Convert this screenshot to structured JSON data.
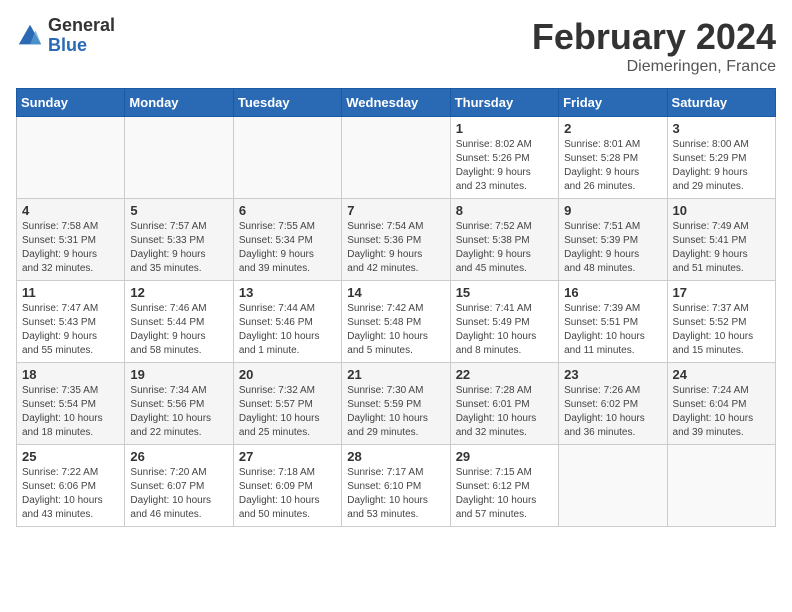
{
  "header": {
    "logo_general": "General",
    "logo_blue": "Blue",
    "month_year": "February 2024",
    "location": "Diemeringen, France"
  },
  "calendar": {
    "days_of_week": [
      "Sunday",
      "Monday",
      "Tuesday",
      "Wednesday",
      "Thursday",
      "Friday",
      "Saturday"
    ],
    "weeks": [
      [
        {
          "day": "",
          "info": ""
        },
        {
          "day": "",
          "info": ""
        },
        {
          "day": "",
          "info": ""
        },
        {
          "day": "",
          "info": ""
        },
        {
          "day": "1",
          "info": "Sunrise: 8:02 AM\nSunset: 5:26 PM\nDaylight: 9 hours\nand 23 minutes."
        },
        {
          "day": "2",
          "info": "Sunrise: 8:01 AM\nSunset: 5:28 PM\nDaylight: 9 hours\nand 26 minutes."
        },
        {
          "day": "3",
          "info": "Sunrise: 8:00 AM\nSunset: 5:29 PM\nDaylight: 9 hours\nand 29 minutes."
        }
      ],
      [
        {
          "day": "4",
          "info": "Sunrise: 7:58 AM\nSunset: 5:31 PM\nDaylight: 9 hours\nand 32 minutes."
        },
        {
          "day": "5",
          "info": "Sunrise: 7:57 AM\nSunset: 5:33 PM\nDaylight: 9 hours\nand 35 minutes."
        },
        {
          "day": "6",
          "info": "Sunrise: 7:55 AM\nSunset: 5:34 PM\nDaylight: 9 hours\nand 39 minutes."
        },
        {
          "day": "7",
          "info": "Sunrise: 7:54 AM\nSunset: 5:36 PM\nDaylight: 9 hours\nand 42 minutes."
        },
        {
          "day": "8",
          "info": "Sunrise: 7:52 AM\nSunset: 5:38 PM\nDaylight: 9 hours\nand 45 minutes."
        },
        {
          "day": "9",
          "info": "Sunrise: 7:51 AM\nSunset: 5:39 PM\nDaylight: 9 hours\nand 48 minutes."
        },
        {
          "day": "10",
          "info": "Sunrise: 7:49 AM\nSunset: 5:41 PM\nDaylight: 9 hours\nand 51 minutes."
        }
      ],
      [
        {
          "day": "11",
          "info": "Sunrise: 7:47 AM\nSunset: 5:43 PM\nDaylight: 9 hours\nand 55 minutes."
        },
        {
          "day": "12",
          "info": "Sunrise: 7:46 AM\nSunset: 5:44 PM\nDaylight: 9 hours\nand 58 minutes."
        },
        {
          "day": "13",
          "info": "Sunrise: 7:44 AM\nSunset: 5:46 PM\nDaylight: 10 hours\nand 1 minute."
        },
        {
          "day": "14",
          "info": "Sunrise: 7:42 AM\nSunset: 5:48 PM\nDaylight: 10 hours\nand 5 minutes."
        },
        {
          "day": "15",
          "info": "Sunrise: 7:41 AM\nSunset: 5:49 PM\nDaylight: 10 hours\nand 8 minutes."
        },
        {
          "day": "16",
          "info": "Sunrise: 7:39 AM\nSunset: 5:51 PM\nDaylight: 10 hours\nand 11 minutes."
        },
        {
          "day": "17",
          "info": "Sunrise: 7:37 AM\nSunset: 5:52 PM\nDaylight: 10 hours\nand 15 minutes."
        }
      ],
      [
        {
          "day": "18",
          "info": "Sunrise: 7:35 AM\nSunset: 5:54 PM\nDaylight: 10 hours\nand 18 minutes."
        },
        {
          "day": "19",
          "info": "Sunrise: 7:34 AM\nSunset: 5:56 PM\nDaylight: 10 hours\nand 22 minutes."
        },
        {
          "day": "20",
          "info": "Sunrise: 7:32 AM\nSunset: 5:57 PM\nDaylight: 10 hours\nand 25 minutes."
        },
        {
          "day": "21",
          "info": "Sunrise: 7:30 AM\nSunset: 5:59 PM\nDaylight: 10 hours\nand 29 minutes."
        },
        {
          "day": "22",
          "info": "Sunrise: 7:28 AM\nSunset: 6:01 PM\nDaylight: 10 hours\nand 32 minutes."
        },
        {
          "day": "23",
          "info": "Sunrise: 7:26 AM\nSunset: 6:02 PM\nDaylight: 10 hours\nand 36 minutes."
        },
        {
          "day": "24",
          "info": "Sunrise: 7:24 AM\nSunset: 6:04 PM\nDaylight: 10 hours\nand 39 minutes."
        }
      ],
      [
        {
          "day": "25",
          "info": "Sunrise: 7:22 AM\nSunset: 6:06 PM\nDaylight: 10 hours\nand 43 minutes."
        },
        {
          "day": "26",
          "info": "Sunrise: 7:20 AM\nSunset: 6:07 PM\nDaylight: 10 hours\nand 46 minutes."
        },
        {
          "day": "27",
          "info": "Sunrise: 7:18 AM\nSunset: 6:09 PM\nDaylight: 10 hours\nand 50 minutes."
        },
        {
          "day": "28",
          "info": "Sunrise: 7:17 AM\nSunset: 6:10 PM\nDaylight: 10 hours\nand 53 minutes."
        },
        {
          "day": "29",
          "info": "Sunrise: 7:15 AM\nSunset: 6:12 PM\nDaylight: 10 hours\nand 57 minutes."
        },
        {
          "day": "",
          "info": ""
        },
        {
          "day": "",
          "info": ""
        }
      ]
    ]
  }
}
